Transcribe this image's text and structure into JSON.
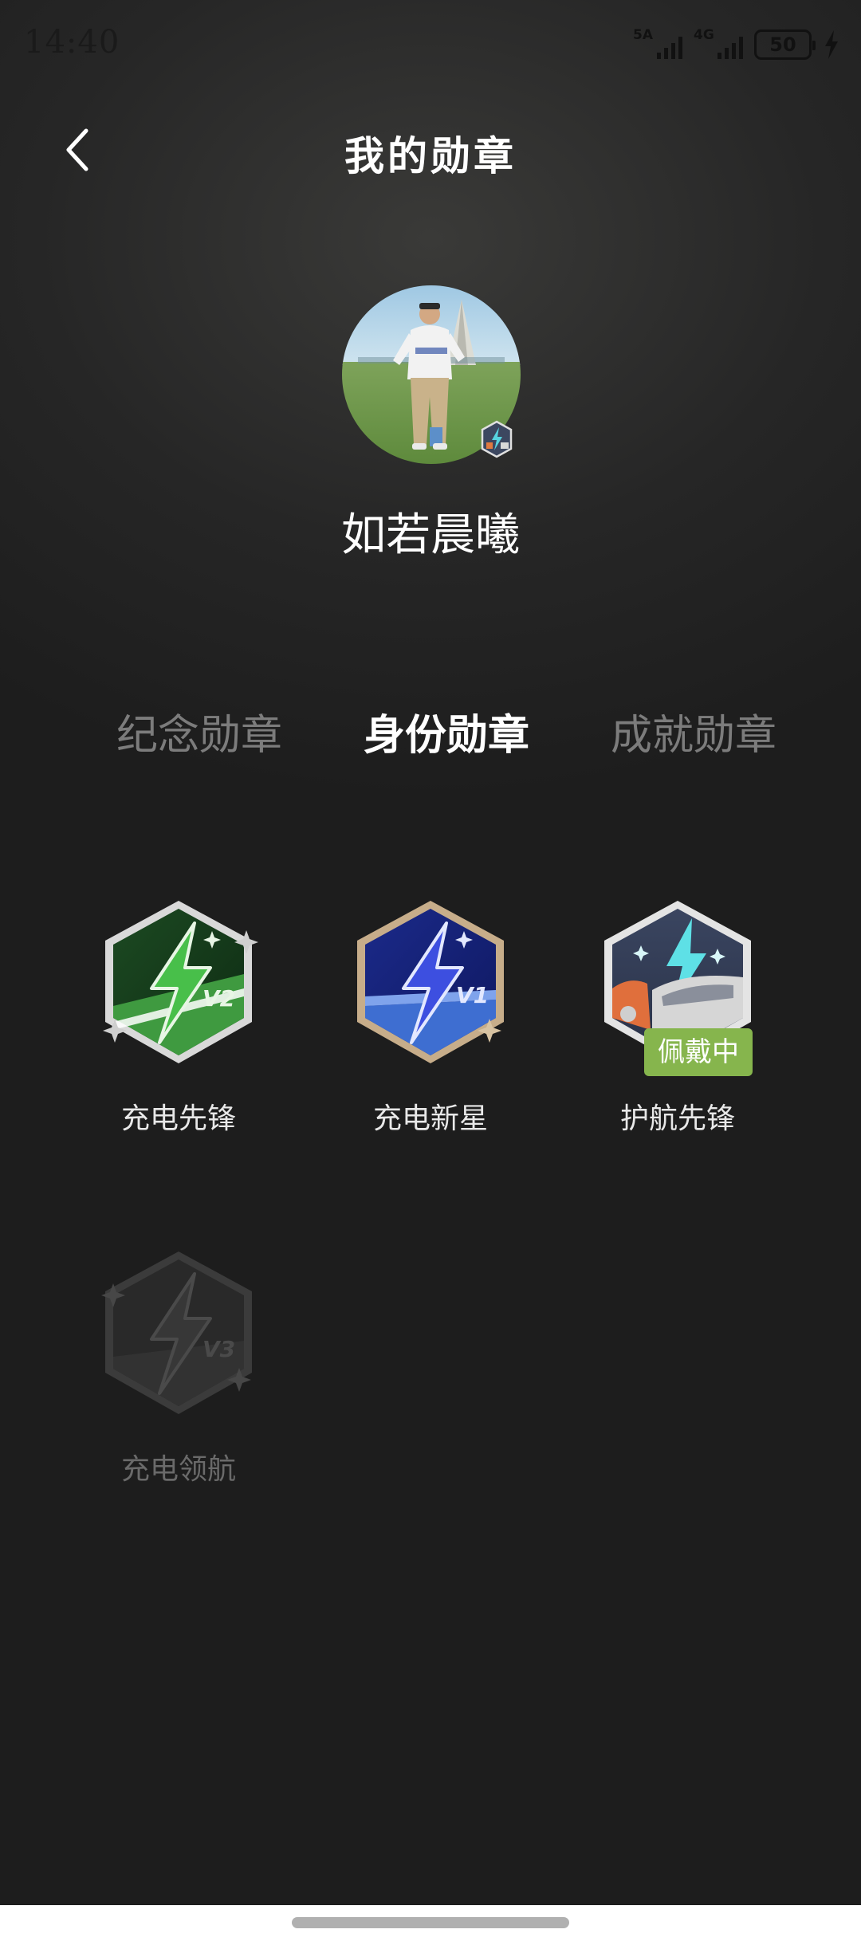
{
  "status_bar": {
    "time": "14:40",
    "signal_1_label": "5A",
    "signal_2_label": "4G",
    "battery_level": "50",
    "charging_icon": "bolt-icon"
  },
  "header": {
    "back_icon": "chevron-left-icon",
    "title": "我的勋章"
  },
  "profile": {
    "username": "如若晨曦"
  },
  "tabs": [
    {
      "label": "纪念勋章",
      "active": false
    },
    {
      "label": "身份勋章",
      "active": true
    },
    {
      "label": "成就勋章",
      "active": false
    }
  ],
  "badges": [
    {
      "label": "充电先锋",
      "level": "V2",
      "color": "#3aa24a",
      "status": "earned"
    },
    {
      "label": "充电新星",
      "level": "V1",
      "color": "#3a4fcf",
      "status": "earned"
    },
    {
      "label": "护航先锋",
      "color": "#3c4760",
      "status": "wearing",
      "tag": "佩戴中"
    },
    {
      "label": "充电领航",
      "level": "V3",
      "color": "#4a4a4a",
      "status": "locked"
    }
  ],
  "colors": {
    "background": "#1e1e1e",
    "active_tab": "#ffffff",
    "inactive_tab": "#7c7c7c",
    "wearing_tag": "#86b54d"
  }
}
